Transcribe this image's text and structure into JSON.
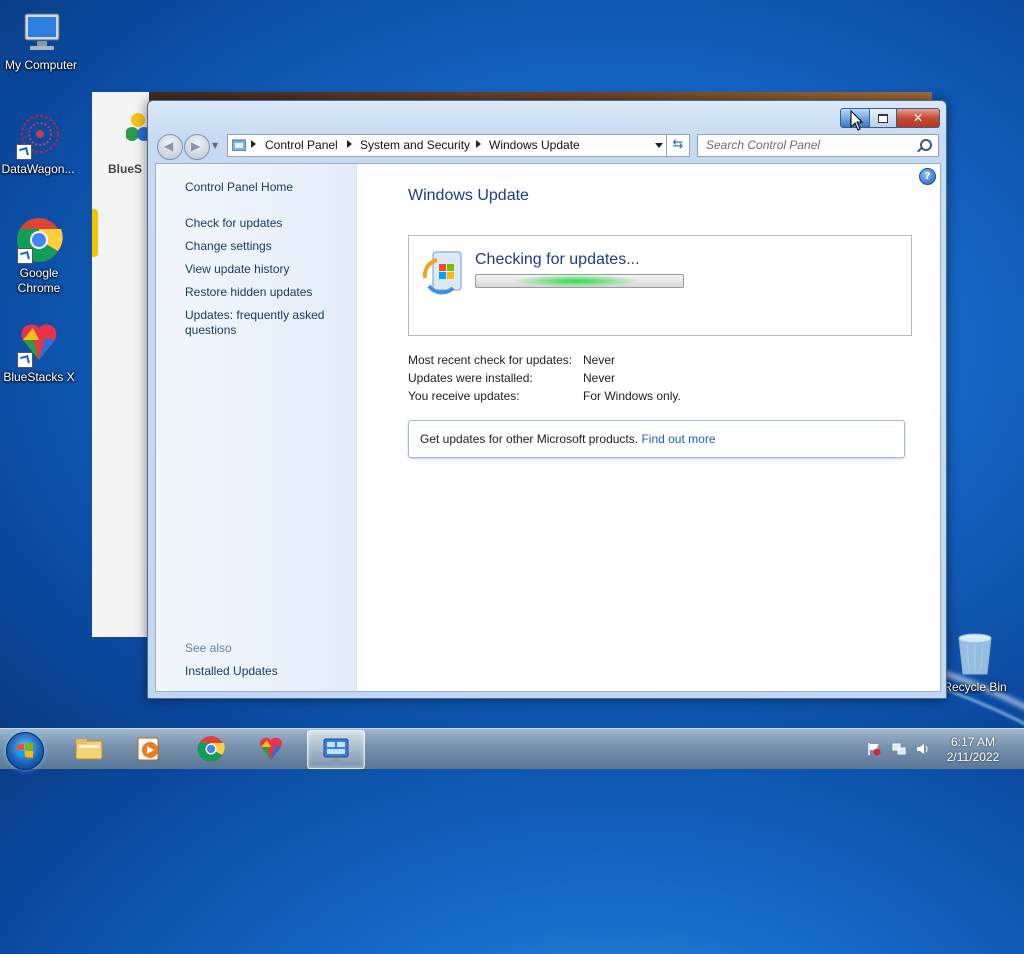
{
  "desktop": {
    "icons": [
      {
        "label": "My Computer",
        "icon": "computer-icon"
      },
      {
        "label": "DataWagon...",
        "icon": "datawagon-icon"
      },
      {
        "label": "Google\nChrome",
        "icon": "chrome-icon"
      },
      {
        "label": "BlueStacks X",
        "icon": "bluestacks-icon"
      },
      {
        "label": "Recycle Bin",
        "icon": "recycle-bin-icon"
      }
    ],
    "background_app_text": "BlueS"
  },
  "window": {
    "address": {
      "crumbs": [
        "Control Panel",
        "System and Security",
        "Windows Update"
      ]
    },
    "search": {
      "placeholder": "Search Control Panel"
    },
    "left_pane": {
      "links": [
        "Control Panel Home",
        "Check for updates",
        "Change settings",
        "View update history",
        "Restore hidden updates",
        "Updates: frequently asked questions"
      ],
      "see_also_label": "See also",
      "see_also_links": [
        "Installed Updates"
      ]
    },
    "main": {
      "title": "Windows Update",
      "status_text": "Checking for updates...",
      "info_rows": [
        {
          "key": "Most recent check for updates:",
          "value": "Never"
        },
        {
          "key": "Updates were installed:",
          "value": "Never"
        },
        {
          "key": "You receive updates:",
          "value": "For Windows only."
        }
      ],
      "other_products": {
        "text": "Get updates for other Microsoft products.",
        "link": "Find out more"
      }
    },
    "help_glyph": "?"
  },
  "taskbar": {
    "items": [
      {
        "icon": "explorer-icon",
        "active": false
      },
      {
        "icon": "media-player-icon",
        "active": false
      },
      {
        "icon": "chrome-icon",
        "active": false
      },
      {
        "icon": "bluestacks-icon",
        "active": false
      },
      {
        "icon": "control-panel-icon",
        "active": true
      }
    ],
    "clock": {
      "time": "6:17 AM",
      "date": "2/11/2022"
    }
  },
  "colors": {
    "title_blue": "#1e3b8a",
    "link_blue": "#1a5fc4",
    "progress_green": "#36d84b"
  }
}
